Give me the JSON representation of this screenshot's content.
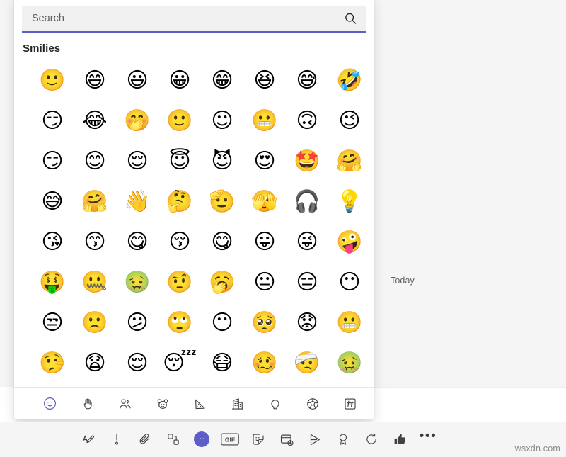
{
  "app": {
    "accent_color": "#5b5fc7",
    "panel_bg": "#ffffff",
    "chat_bg": "#f5f5f5",
    "watermark": "wsxdn.com"
  },
  "picker": {
    "search": {
      "placeholder": "Search",
      "value": "",
      "icon": "search-icon"
    },
    "section_title": "Smilies",
    "rows": [
      [
        {
          "name": "slightly-smiling-face",
          "glyph": "🙂"
        },
        {
          "name": "grinning-face",
          "glyph": "😄"
        },
        {
          "name": "grinning-face-with-big-eyes",
          "glyph": "😃"
        },
        {
          "name": "grinning-face-open-mouth",
          "glyph": "😀"
        },
        {
          "name": "beaming-face-with-smiling-eyes",
          "glyph": "😁"
        },
        {
          "name": "grinning-squinting-face",
          "glyph": "😆"
        },
        {
          "name": "face-with-tears-of-joy",
          "glyph": "😅"
        },
        {
          "name": "rolling-on-the-floor-laughing",
          "glyph": "🤣"
        }
      ],
      [
        {
          "name": "grinning-face-with-smirk",
          "glyph": "😏"
        },
        {
          "name": "face-with-tears-of-joy-crying",
          "glyph": "😂"
        },
        {
          "name": "face-with-hand-over-mouth",
          "glyph": "🤭"
        },
        {
          "name": "slightly-smiling-face-2",
          "glyph": "🙂"
        },
        {
          "name": "smiling-face",
          "glyph": "☺"
        },
        {
          "name": "grimacing-face",
          "glyph": "😬"
        },
        {
          "name": "upside-down-face",
          "glyph": "🙃"
        },
        {
          "name": "winking-face",
          "glyph": "😉"
        }
      ],
      [
        {
          "name": "smirking-face",
          "glyph": "😏"
        },
        {
          "name": "smiling-face-with-blush",
          "glyph": "😊"
        },
        {
          "name": "relieved-face",
          "glyph": "😌"
        },
        {
          "name": "smiling-face-with-halo",
          "glyph": "😇"
        },
        {
          "name": "smiling-face-with-horns",
          "glyph": "😈"
        },
        {
          "name": "smiling-face-with-heart-eyes",
          "glyph": "😍"
        },
        {
          "name": "star-struck",
          "glyph": "🤩"
        },
        {
          "name": "face-with-hand",
          "glyph": "🤗"
        }
      ],
      [
        {
          "name": "face-with-cold-sweat",
          "glyph": "😅"
        },
        {
          "name": "hugging-face",
          "glyph": "🤗"
        },
        {
          "name": "waving-face",
          "glyph": "👋"
        },
        {
          "name": "thinking-face",
          "glyph": "🤔"
        },
        {
          "name": "saluting-face",
          "glyph": "🫡"
        },
        {
          "name": "peeking-face",
          "glyph": "🫣"
        },
        {
          "name": "face-with-headphones",
          "glyph": "🎧"
        },
        {
          "name": "face-with-idea",
          "glyph": "💡"
        }
      ],
      [
        {
          "name": "face-blowing-a-kiss",
          "glyph": "😘"
        },
        {
          "name": "kissing-face",
          "glyph": "😙"
        },
        {
          "name": "face-savoring-food",
          "glyph": "😋"
        },
        {
          "name": "kissing-face-with-closed-eyes",
          "glyph": "😚"
        },
        {
          "name": "yum-face",
          "glyph": "😋"
        },
        {
          "name": "face-with-tongue",
          "glyph": "😛"
        },
        {
          "name": "winking-face-with-tongue",
          "glyph": "😜"
        },
        {
          "name": "zany-face",
          "glyph": "🤪"
        }
      ],
      [
        {
          "name": "money-mouth-face",
          "glyph": "🤑"
        },
        {
          "name": "zipper-mouth-face",
          "glyph": "🤐"
        },
        {
          "name": "nauseated-face",
          "glyph": "🤢"
        },
        {
          "name": "face-with-raised-eyebrow",
          "glyph": "🤨"
        },
        {
          "name": "face-with-clock",
          "glyph": "🥱"
        },
        {
          "name": "neutral-face",
          "glyph": "😐"
        },
        {
          "name": "expressionless-face",
          "glyph": "😑"
        },
        {
          "name": "face-without-mouth",
          "glyph": "😶"
        }
      ],
      [
        {
          "name": "unamused-face",
          "glyph": "😒"
        },
        {
          "name": "slightly-frowning-face",
          "glyph": "🙁"
        },
        {
          "name": "confused-face",
          "glyph": "😕"
        },
        {
          "name": "face-with-rolling-eyes",
          "glyph": "🙄"
        },
        {
          "name": "face-with-hair-over-eye",
          "glyph": "😶"
        },
        {
          "name": "pleading-face",
          "glyph": "🥺"
        },
        {
          "name": "worried-face",
          "glyph": "😟"
        },
        {
          "name": "grimacing-face-with-braces",
          "glyph": "😬"
        }
      ],
      [
        {
          "name": "lying-face",
          "glyph": "🤥"
        },
        {
          "name": "anguished-face",
          "glyph": "😧"
        },
        {
          "name": "sleepy-relieved-face",
          "glyph": "😌"
        },
        {
          "name": "sleeping-face",
          "glyph": "😴"
        },
        {
          "name": "sneezing-face-with-mask",
          "glyph": "😷"
        },
        {
          "name": "face-with-thermometer",
          "glyph": "🥴"
        },
        {
          "name": "face-with-head-bandage",
          "glyph": "🤕"
        },
        {
          "name": "nauseated-green-face",
          "glyph": "🤢"
        }
      ]
    ],
    "categories": [
      {
        "name": "smilies",
        "label": "Smilies",
        "icon": "smiley-icon",
        "active": true
      },
      {
        "name": "hand-gestures",
        "label": "Hand gestures",
        "icon": "hand-icon",
        "active": false
      },
      {
        "name": "people",
        "label": "People",
        "icon": "people-icon",
        "active": false
      },
      {
        "name": "animals",
        "label": "Animals and nature",
        "icon": "bear-icon",
        "active": false
      },
      {
        "name": "food",
        "label": "Food and drink",
        "icon": "pizza-icon",
        "active": false
      },
      {
        "name": "travel",
        "label": "Travel and places",
        "icon": "building-icon",
        "active": false
      },
      {
        "name": "objects",
        "label": "Objects",
        "icon": "lightbulb-icon",
        "active": false
      },
      {
        "name": "activities",
        "label": "Activities",
        "icon": "soccer-ball-icon",
        "active": false
      },
      {
        "name": "symbols",
        "label": "Symbols",
        "icon": "hash-icon",
        "active": false
      }
    ]
  },
  "chat": {
    "today_label": "Today"
  },
  "toolbar": {
    "items": [
      {
        "name": "format-button",
        "label": "Format",
        "icon": "format-pen-icon",
        "active": false
      },
      {
        "name": "importance-button",
        "label": "Set delivery options",
        "icon": "exclamation-icon",
        "active": false
      },
      {
        "name": "attach-button",
        "label": "Attach",
        "icon": "paperclip-icon",
        "active": false
      },
      {
        "name": "loop-component-button",
        "label": "Loop components",
        "icon": "loop-shapes-icon",
        "active": false
      },
      {
        "name": "emoji-button",
        "label": "Emoji",
        "icon": "emoji-icon",
        "active": true
      },
      {
        "name": "giphy-button",
        "label": "GIF",
        "icon": "gif-icon",
        "active": false
      },
      {
        "name": "sticker-button",
        "label": "Sticker",
        "icon": "sticker-icon",
        "active": false
      },
      {
        "name": "schedule-send-button",
        "label": "Schedule send",
        "icon": "calendar-plus-icon",
        "active": false
      },
      {
        "name": "stream-button",
        "label": "Stream",
        "icon": "play-forward-icon",
        "active": false
      },
      {
        "name": "praise-button",
        "label": "Praise",
        "icon": "praise-badge-icon",
        "active": false
      },
      {
        "name": "loop-poll-button",
        "label": "Update",
        "icon": "refresh-icon",
        "active": false
      },
      {
        "name": "approvals-button",
        "label": "Approvals",
        "icon": "thumbs-icon",
        "active": false
      },
      {
        "name": "more-options-button",
        "label": "More options",
        "icon": "ellipsis-icon",
        "active": false
      }
    ],
    "more_glyph": "•••"
  }
}
